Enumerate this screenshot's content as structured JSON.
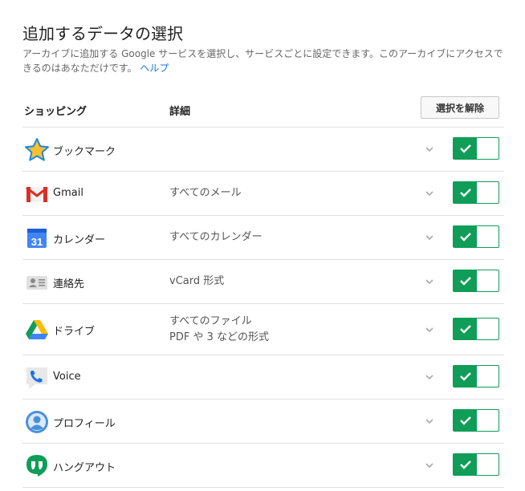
{
  "page": {
    "title": "追加するデータの選択",
    "description": "アーカイブに追加する Google サービスを選択し、サービスごとに設定できます。このアーカイブにアクセスできるのはあなただけです。",
    "help_link": "ヘルプ"
  },
  "header": {
    "col_service": "ショッピング",
    "col_details": "詳細",
    "deselect_button": "選択を解除"
  },
  "services": [
    {
      "name": "ブックマーク",
      "icon": "star-icon",
      "details": [],
      "enabled": true
    },
    {
      "name": "Gmail",
      "icon": "gmail-icon",
      "details": [
        "すべてのメール"
      ],
      "enabled": true
    },
    {
      "name": "カレンダー",
      "icon": "calendar-icon",
      "icon_text": "31",
      "details": [
        "すべてのカレンダー"
      ],
      "enabled": true
    },
    {
      "name": "連絡先",
      "icon": "contacts-icon",
      "details": [
        "vCard 形式"
      ],
      "enabled": true
    },
    {
      "name": "ドライブ",
      "icon": "drive-icon",
      "details": [
        "すべてのファイル",
        "PDF や 3 などの形式"
      ],
      "enabled": true
    },
    {
      "name": "Voice",
      "icon": "voice-icon",
      "details": [],
      "enabled": true
    },
    {
      "name": "プロフィール",
      "icon": "profile-icon",
      "details": [],
      "enabled": true
    },
    {
      "name": "ハングアウト",
      "icon": "hangouts-icon",
      "details": [],
      "enabled": true
    }
  ],
  "colors": {
    "toggle_on": "#0f9d58",
    "link": "#1a73e8"
  }
}
